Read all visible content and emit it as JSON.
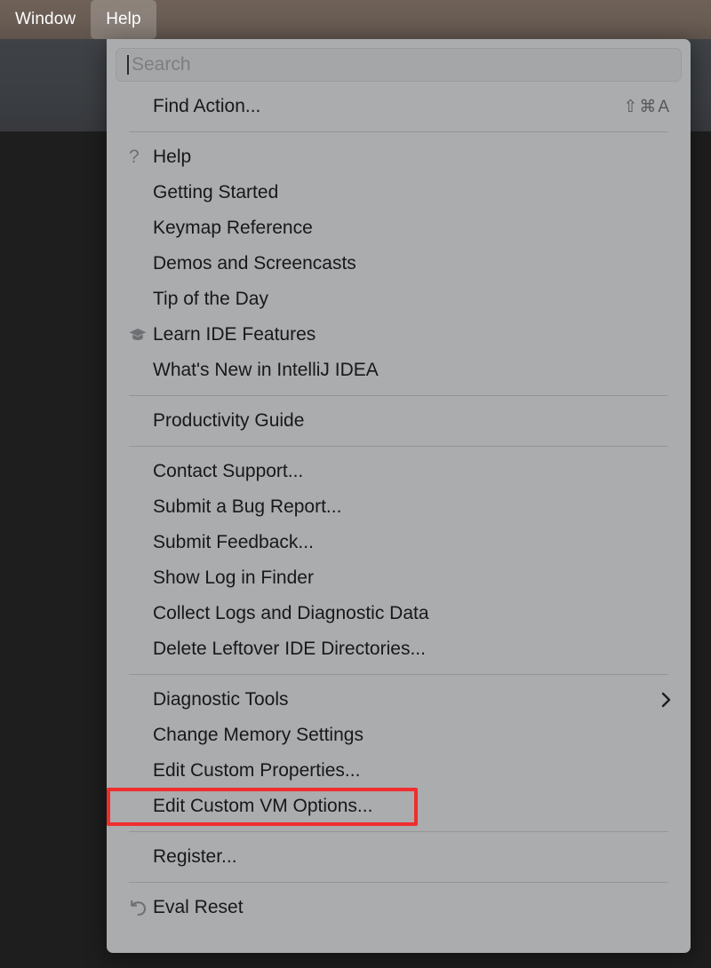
{
  "menubar": {
    "items": [
      {
        "label": "Window",
        "active": false
      },
      {
        "label": "Help",
        "active": true
      }
    ]
  },
  "help_menu": {
    "search": {
      "placeholder": "Search",
      "value": ""
    },
    "groups": [
      {
        "items": [
          {
            "label": "Find Action...",
            "icon": "",
            "shortcut": "⇧⌘A",
            "submenu": false
          }
        ]
      },
      {
        "items": [
          {
            "label": "Help",
            "icon": "question-mark-icon",
            "glyph": "?",
            "shortcut": "",
            "submenu": false
          },
          {
            "label": "Getting Started",
            "icon": "",
            "shortcut": "",
            "submenu": false
          },
          {
            "label": "Keymap Reference",
            "icon": "",
            "shortcut": "",
            "submenu": false
          },
          {
            "label": "Demos and Screencasts",
            "icon": "",
            "shortcut": "",
            "submenu": false
          },
          {
            "label": "Tip of the Day",
            "icon": "",
            "shortcut": "",
            "submenu": false
          },
          {
            "label": "Learn IDE Features",
            "icon": "graduation-cap-icon",
            "shortcut": "",
            "submenu": false
          },
          {
            "label": "What's New in IntelliJ IDEA",
            "icon": "",
            "shortcut": "",
            "submenu": false
          }
        ]
      },
      {
        "items": [
          {
            "label": "Productivity Guide",
            "icon": "",
            "shortcut": "",
            "submenu": false
          }
        ]
      },
      {
        "items": [
          {
            "label": "Contact Support...",
            "icon": "",
            "shortcut": "",
            "submenu": false
          },
          {
            "label": "Submit a Bug Report...",
            "icon": "",
            "shortcut": "",
            "submenu": false
          },
          {
            "label": "Submit Feedback...",
            "icon": "",
            "shortcut": "",
            "submenu": false
          },
          {
            "label": "Show Log in Finder",
            "icon": "",
            "shortcut": "",
            "submenu": false
          },
          {
            "label": "Collect Logs and Diagnostic Data",
            "icon": "",
            "shortcut": "",
            "submenu": false
          },
          {
            "label": "Delete Leftover IDE Directories...",
            "icon": "",
            "shortcut": "",
            "submenu": false
          }
        ]
      },
      {
        "items": [
          {
            "label": "Diagnostic Tools",
            "icon": "",
            "shortcut": "",
            "submenu": true
          },
          {
            "label": "Change Memory Settings",
            "icon": "",
            "shortcut": "",
            "submenu": false
          },
          {
            "label": "Edit Custom Properties...",
            "icon": "",
            "shortcut": "",
            "submenu": false
          },
          {
            "label": "Edit Custom VM Options...",
            "icon": "",
            "shortcut": "",
            "submenu": false,
            "highlighted": true
          }
        ]
      },
      {
        "items": [
          {
            "label": "Register...",
            "icon": "",
            "shortcut": "",
            "submenu": false
          }
        ]
      },
      {
        "items": [
          {
            "label": "Eval Reset",
            "icon": "undo-arrow-icon",
            "shortcut": "",
            "submenu": false
          }
        ]
      }
    ]
  },
  "annotation": {
    "highlight_color": "#f12d2d",
    "target_label": "Edit Custom VM Options..."
  }
}
